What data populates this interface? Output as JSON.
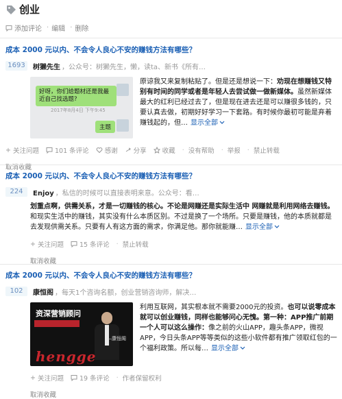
{
  "topic": {
    "title": "创业",
    "actions": [
      "添加评论",
      "编辑",
      "删除"
    ]
  },
  "questions": [
    {
      "title": "成本 2000 元以内、不会令人良心不安的赚钱方法有哪些？",
      "votes": "1693",
      "author": "树獭先生",
      "author_meta": "，公众号：树獭先生，懒，读ta、新书《所有…",
      "image_text": "好呀，你们给题材还是我最近自己找选题?",
      "image_time": "2017年8月4日 下午9:45",
      "image_reply": "主题",
      "text_normal_1": "原谅我又来复制粘贴了。但是还是想说一下：",
      "text_bold_1": "劝现在想赚钱又特别有时间的同学或者是年轻人去尝试做一做新媒体。",
      "text_normal_2": "虽然新媒体最大的红利已经过去了，但是现在进去还是可以赚很多钱的，只要认真去做，初期好好学习一下套路。有时候你最初可能是弃着赚钱起的，但…",
      "more": "显示全部",
      "meta": [
        "关注问题",
        "101 条评论",
        "感谢",
        "分享",
        "收藏",
        "没有帮助",
        "举报",
        "禁止转载"
      ],
      "cancel": "取消收藏"
    },
    {
      "title": "成本 2000 元以内、不会令人良心不安的赚钱方法有哪些？",
      "votes": "224",
      "author": "Enjoy",
      "author_meta": "，私信的时候可以直接表明来意。公众号：看…",
      "text_bold_1": "划重点啊，供需关系，才是一切赚钱的核心。不论是网赚还是实际生活中 网赚就是利用网络去赚钱。",
      "text_normal_1": "和现实生活中的赚钱，其实没有什么本质区别。不过是换了一个场所。只要是赚钱，他的本质就都是去发现供需关系。只要有人有这方面的需求，你满足他。那你就能赚…",
      "more": "显示全部",
      "meta": [
        "关注问题",
        "15 条评论",
        "禁止转载"
      ],
      "cancel": "取消收藏"
    },
    {
      "title": "成本 2000 元以内、不会令人良心不安的赚钱方法有哪些？",
      "votes": "102",
      "author": "康恒阁",
      "author_meta": "，每天1个咨询名额，创业营销咨询师，解决…",
      "poster_title": "资深营销顾问",
      "poster_sub": "—康恒阁",
      "poster_brand": "hengge",
      "text_normal_1": "利用互联网，其实根本就不需要2000元的投资。",
      "text_bold_1": "也可以说零成本就可以创业赚钱，同样也能够问心无愧。第一种：APP推广前期一个人可以这么操作：",
      "text_normal_2": "像之前的火山APP，趣头条APP，微视APP，今日头条APP等等类似的这些小软件都有推广领取红包的一个福利政策。所以每…",
      "more": "显示全部",
      "meta": [
        "关注问题",
        "19 条评论",
        "作者保留权利"
      ],
      "cancel": "取消收藏"
    }
  ]
}
